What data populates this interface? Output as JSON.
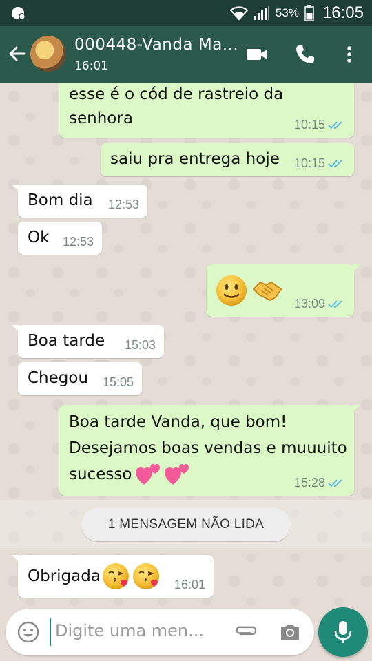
{
  "status_bar": {
    "battery_percent": "53%",
    "time": "16:05"
  },
  "header": {
    "contact_name": "000448-Vanda Ma...",
    "subtitle": "16:01"
  },
  "messages": [
    {
      "direction": "out",
      "lines": [
        "esse é o cód de rastreio da",
        "senhora"
      ],
      "time": "10:15",
      "status": "read"
    },
    {
      "direction": "out",
      "lines": [
        "saiu pra entrega hoje"
      ],
      "time": "10:15",
      "status": "read"
    },
    {
      "direction": "in",
      "lines": [
        "Bom dia"
      ],
      "time": "12:53"
    },
    {
      "direction": "in",
      "lines": [
        "Ok"
      ],
      "time": "12:53"
    },
    {
      "direction": "out",
      "emojis": [
        "slightly-smiling-face",
        "handshake"
      ],
      "time": "13:09",
      "status": "read"
    },
    {
      "direction": "in",
      "lines": [
        "Boa tarde"
      ],
      "time": "15:03"
    },
    {
      "direction": "in",
      "lines": [
        "Chegou"
      ],
      "time": "15:05"
    },
    {
      "direction": "out",
      "lines": [
        "Boa tarde Vanda, que bom!",
        "Desejamos boas vendas e muuuito",
        "sucesso"
      ],
      "emojis": [
        "two-hearts",
        "two-hearts"
      ],
      "time": "15:28",
      "status": "read"
    },
    {
      "direction": "in",
      "lines": [
        "Obrigada"
      ],
      "emojis": [
        "face-blowing-kiss",
        "face-blowing-kiss"
      ],
      "time": "16:01"
    }
  ],
  "unread_divider": "1 MENSAGEM NÃO LIDA",
  "composer": {
    "placeholder": "Digite uma men..."
  },
  "colors": {
    "header": "#2b5a4c",
    "status_bar": "#1f3f36",
    "outgoing_bubble": "#dcf8c6",
    "incoming_bubble": "#ffffff",
    "read_ticks": "#4fb6ec",
    "fab": "#1e8a77"
  },
  "icons": {
    "header": [
      "back-arrow-icon",
      "video-call-icon",
      "phone-icon",
      "more-vert-icon"
    ],
    "composer": [
      "emoji-icon",
      "attach-icon",
      "camera-icon",
      "mic-icon"
    ]
  }
}
